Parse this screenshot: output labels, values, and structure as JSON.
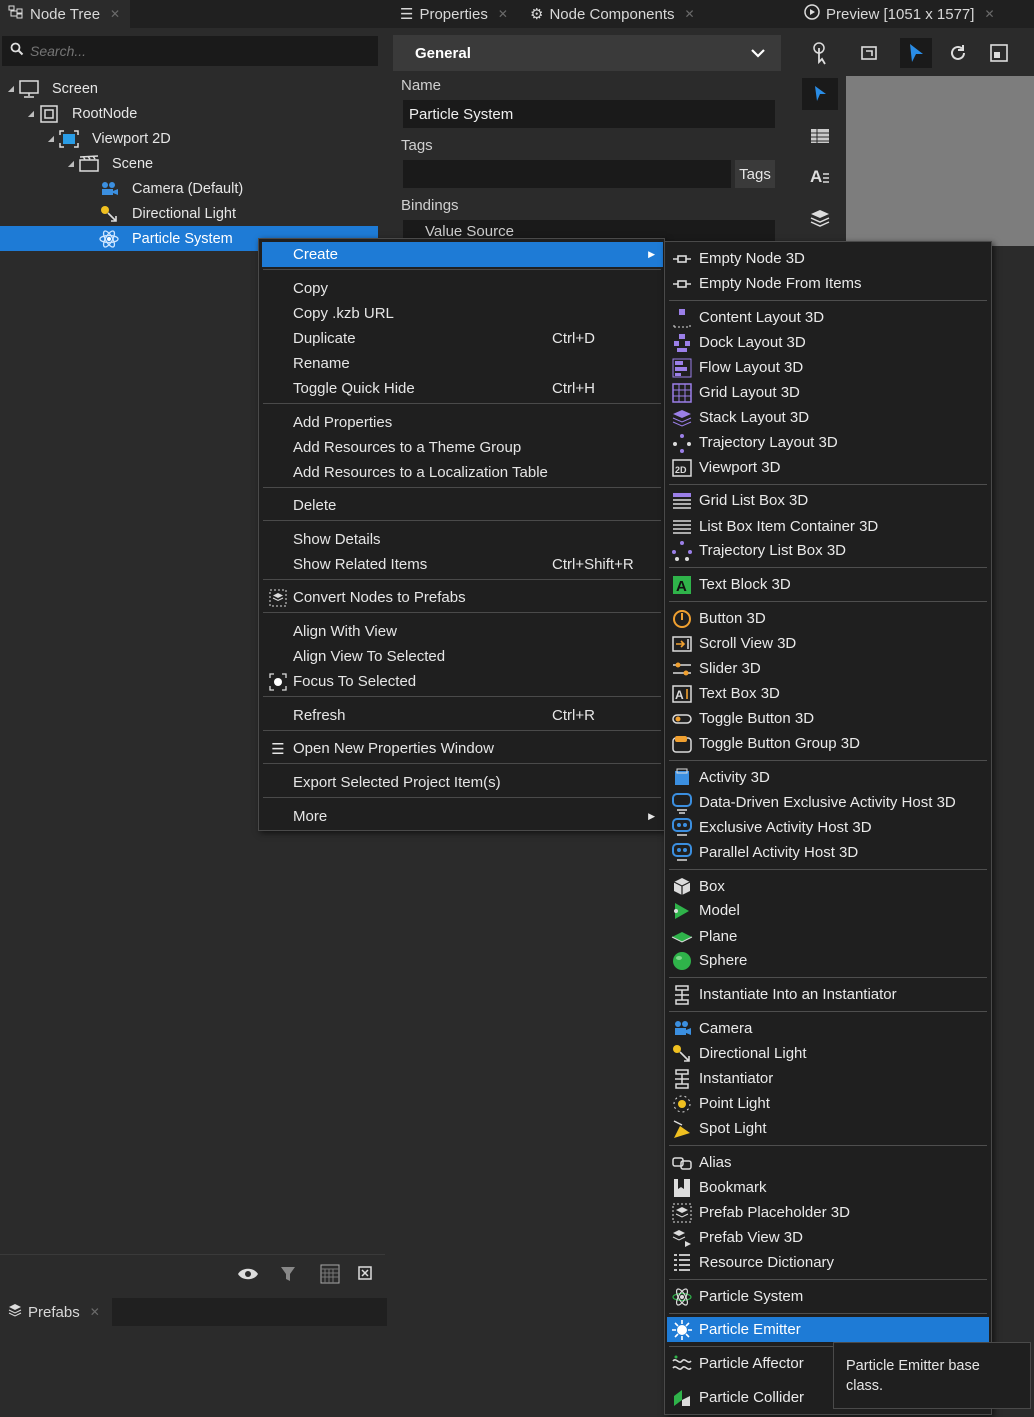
{
  "node_tree": {
    "tab_label": "Node Tree",
    "search_placeholder": "Search...",
    "items": [
      {
        "label": "Screen",
        "icon": "screen-icon"
      },
      {
        "label": "RootNode",
        "icon": "root-node-icon"
      },
      {
        "label": "Viewport 2D",
        "icon": "viewport-icon"
      },
      {
        "label": "Scene",
        "icon": "scene-icon"
      },
      {
        "label": "Camera (Default)",
        "icon": "camera-icon"
      },
      {
        "label": "Directional Light",
        "icon": "directional-light-icon"
      },
      {
        "label": "Particle System",
        "icon": "particle-system-icon",
        "selected": true
      }
    ]
  },
  "prefabs": {
    "tab_label": "Prefabs"
  },
  "properties": {
    "tab_label": "Properties",
    "components_tab_label": "Node Components",
    "section": "General",
    "name_label": "Name",
    "name_value": "Particle System",
    "tags_label": "Tags",
    "tags_button": "Tags",
    "bindings_label": "Bindings",
    "bindings_value": "Value Source"
  },
  "preview": {
    "tab_label": "Preview [1051 x 1577]"
  },
  "context_menu": {
    "create": "Create",
    "copy": "Copy",
    "copy_url": "Copy .kzb URL",
    "duplicate": "Duplicate",
    "duplicate_sc": "Ctrl+D",
    "rename": "Rename",
    "toggle_hide": "Toggle Quick Hide",
    "toggle_hide_sc": "Ctrl+H",
    "add_props": "Add Properties",
    "add_theme": "Add Resources to a Theme Group",
    "add_loc": "Add Resources to a Localization Table",
    "delete": "Delete",
    "show_details": "Show Details",
    "show_related": "Show Related Items",
    "show_related_sc": "Ctrl+Shift+R",
    "convert": "Convert Nodes to Prefabs",
    "align_with": "Align With View",
    "align_to": "Align View To Selected",
    "focus": "Focus To Selected",
    "refresh": "Refresh",
    "refresh_sc": "Ctrl+R",
    "open_props": "Open New Properties Window",
    "export": "Export Selected Project Item(s)",
    "more": "More"
  },
  "create_menu": [
    "Empty Node 3D",
    "Empty Node From Items",
    "Content Layout 3D",
    "Dock Layout 3D",
    "Flow Layout 3D",
    "Grid Layout 3D",
    "Stack Layout 3D",
    "Trajectory Layout 3D",
    "Viewport 3D",
    "Grid List Box 3D",
    "List Box Item Container 3D",
    "Trajectory List Box 3D",
    "Text Block 3D",
    "Button 3D",
    "Scroll View 3D",
    "Slider 3D",
    "Text Box 3D",
    "Toggle Button 3D",
    "Toggle Button Group 3D",
    "Activity 3D",
    "Data-Driven Exclusive Activity Host 3D",
    "Exclusive Activity Host 3D",
    "Parallel Activity Host 3D",
    "Box",
    "Model",
    "Plane",
    "Sphere",
    "Instantiate Into an Instantiator",
    "Camera",
    "Directional Light",
    "Instantiator",
    "Point Light",
    "Spot Light",
    "Alias",
    "Bookmark",
    "Prefab Placeholder 3D",
    "Prefab View 3D",
    "Resource Dictionary",
    "Particle System",
    "Particle Emitter",
    "Particle Affector",
    "Particle Collider"
  ],
  "tooltip": "Particle Emitter base class.",
  "colors": {
    "accent": "#1e7bd6",
    "background": "#2b2b2b",
    "menu": "#1f1f1f"
  }
}
